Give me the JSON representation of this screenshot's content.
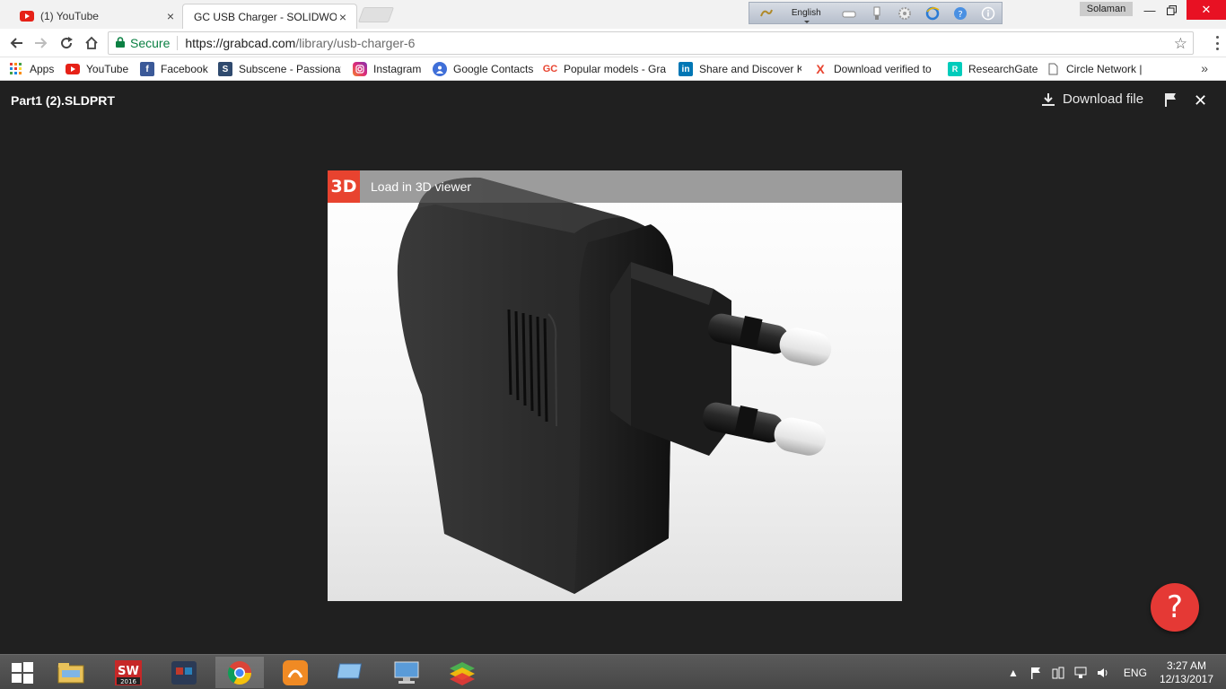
{
  "browser": {
    "tabs": [
      {
        "title": "(1) YouTube",
        "favicon": "youtube-icon",
        "active": false
      },
      {
        "title": "GC  USB Charger - SOLIDWO",
        "favicon": "grabcad-icon",
        "active": true
      }
    ],
    "lang_toolbar": {
      "language": "English"
    },
    "user": "Solaman",
    "address": {
      "secure_label": "Secure",
      "url_scheme_host": "https://grabcad.com",
      "url_path": "/library/usb-charger-6"
    },
    "bookmarks": [
      {
        "label": "Apps",
        "icon": "apps-grid-icon"
      },
      {
        "label": "YouTube",
        "icon": "youtube-icon"
      },
      {
        "label": "Facebook",
        "icon": "facebook-icon"
      },
      {
        "label": "Subscene - Passionat",
        "icon": "subscene-icon"
      },
      {
        "label": "Instagram",
        "icon": "instagram-icon"
      },
      {
        "label": "Google Contacts",
        "icon": "contacts-icon"
      },
      {
        "label": "Popular models - Gra",
        "icon": "grabcad-icon"
      },
      {
        "label": "Share and Discover K",
        "icon": "linkedin-icon"
      },
      {
        "label": "Download verified to",
        "icon": "x-icon"
      },
      {
        "label": "ResearchGate",
        "icon": "researchgate-icon"
      },
      {
        "label": "Circle Network |",
        "icon": "page-icon"
      }
    ],
    "bookmarks_more": "»"
  },
  "viewer": {
    "file_name": "Part1 (2).SLDPRT",
    "download_label": "Download file",
    "badge_3d": "3D",
    "load_3d_label": "Load in 3D viewer",
    "help_label": "?"
  },
  "taskbar": {
    "language": "ENG",
    "time": "3:27 AM",
    "date": "12/13/2017"
  },
  "colors": {
    "accent_red": "#e8432f",
    "help_red": "#e53935",
    "secure_green": "#0b8043",
    "page_bg": "#202020"
  }
}
